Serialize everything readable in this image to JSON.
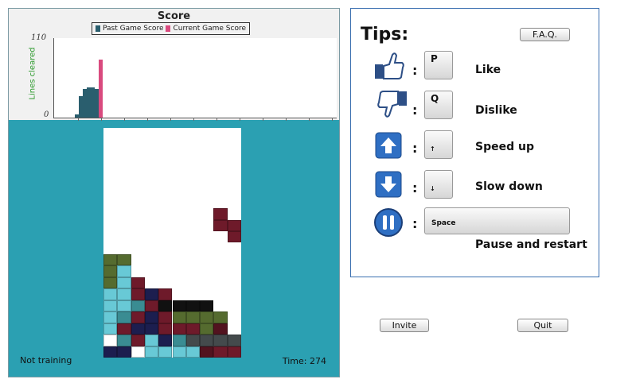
{
  "chart_data": {
    "type": "bar",
    "title": "Score",
    "ylabel": "Lines cleared",
    "ylim": [
      0,
      110
    ],
    "yticks": [
      "110",
      "0"
    ],
    "series": [
      {
        "name": "Past Game Score",
        "color": "#2a5e6e",
        "values": [
          4,
          30,
          40,
          42,
          42,
          40
        ]
      },
      {
        "name": "Current Game Score",
        "color": "#d94a7e",
        "values": [
          80
        ]
      }
    ]
  },
  "game": {
    "status": "Not training",
    "time": "Time: 274"
  },
  "tips": {
    "title": "Tips:",
    "faq_label": "F.A.Q.",
    "items": [
      {
        "key": "P",
        "label": "Like",
        "icon": "thumbs-up-icon"
      },
      {
        "key": "Q",
        "label": "Dislike",
        "icon": "thumbs-down-icon"
      },
      {
        "key": "↑",
        "label": "Speed up",
        "icon": "arrow-up-icon"
      },
      {
        "key": "↓",
        "label": "Slow down",
        "icon": "arrow-down-icon"
      },
      {
        "key": "Space",
        "label": "Pause and restart",
        "icon": "pause-icon"
      }
    ]
  },
  "buttons": {
    "invite": "Invite",
    "quit": "Quit"
  },
  "colors": {
    "background": "#2ba0b2",
    "board": "#ffffff",
    "tips_border": "#3a6fb0"
  }
}
